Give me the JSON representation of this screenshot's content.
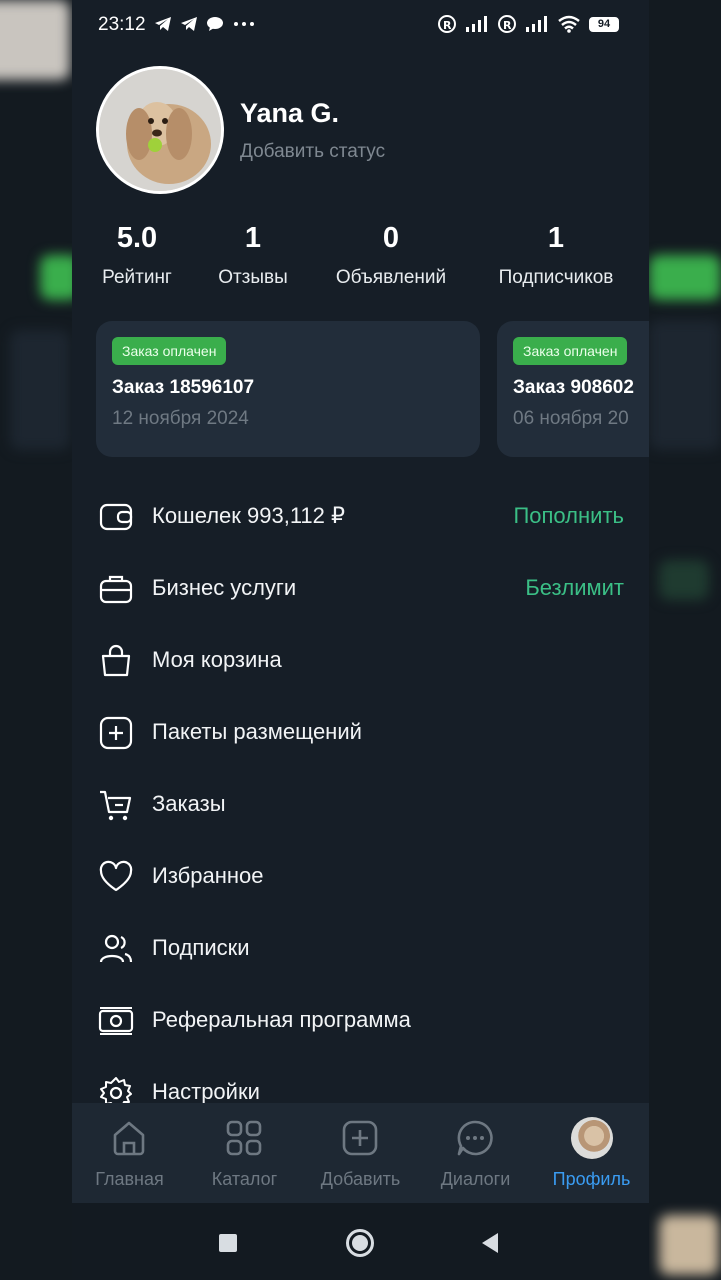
{
  "status_bar": {
    "time": "23:12",
    "battery": "94"
  },
  "profile": {
    "name": "Yana G.",
    "status_placeholder": "Добавить статус"
  },
  "stats": [
    {
      "value": "5.0",
      "label": "Рейтинг"
    },
    {
      "value": "1",
      "label": "Отзывы"
    },
    {
      "value": "0",
      "label": "Объявлений"
    },
    {
      "value": "1",
      "label": "Подписчиков"
    }
  ],
  "orders": [
    {
      "badge": "Заказ оплачен",
      "title": "Заказ 18596107",
      "date": "12 ноября 2024"
    },
    {
      "badge": "Заказ оплачен",
      "title": "Заказ 908602",
      "date": "06 ноября 20"
    }
  ],
  "menu": [
    {
      "label": "Кошелек 993,112 ₽",
      "action": "Пополнить",
      "icon": "wallet-icon"
    },
    {
      "label": "Бизнес услуги",
      "action": "Безлимит",
      "icon": "briefcase-icon"
    },
    {
      "label": "Моя корзина",
      "action": "",
      "icon": "bag-icon"
    },
    {
      "label": "Пакеты размещений",
      "action": "",
      "icon": "add-square-icon"
    },
    {
      "label": "Заказы",
      "action": "",
      "icon": "cart-icon"
    },
    {
      "label": "Избранное",
      "action": "",
      "icon": "heart-icon"
    },
    {
      "label": "Подписки",
      "action": "",
      "icon": "users-icon"
    },
    {
      "label": "Реферальная программа",
      "action": "",
      "icon": "money-icon"
    },
    {
      "label": "Настройки",
      "action": "",
      "icon": "gear-icon"
    }
  ],
  "tabs": [
    {
      "label": "Главная",
      "icon": "home-icon"
    },
    {
      "label": "Каталог",
      "icon": "grid-icon"
    },
    {
      "label": "Добавить",
      "icon": "add-square-icon"
    },
    {
      "label": "Диалоги",
      "icon": "chat-icon"
    },
    {
      "label": "Профиль",
      "icon": "avatar"
    }
  ],
  "colors": {
    "background": "#161e27",
    "card": "#222d3a",
    "accent_green": "#3bbf86",
    "badge_green": "#3aae4c",
    "active_tab": "#3a9cf2"
  }
}
